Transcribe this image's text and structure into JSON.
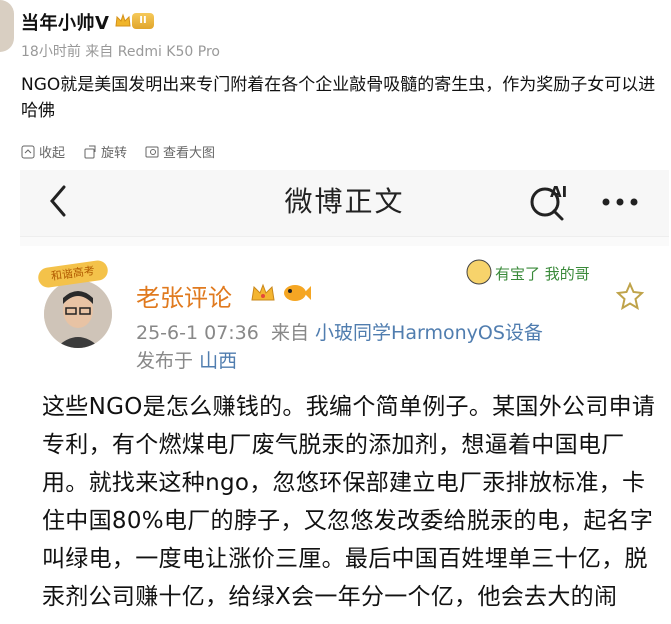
{
  "outer_post": {
    "username": "当年小帅V",
    "badge_level": "II",
    "time": "18小时前",
    "source": "来自 Redmi K50 Pro",
    "text": "NGO就是美国发明出来专门附着在各个企业敲骨吸髓的寄生虫，作为奖励子女可以进哈佛",
    "actions": [
      {
        "label": "收起",
        "icon": "collapse-icon"
      },
      {
        "label": "旋转",
        "icon": "rotate-icon"
      },
      {
        "label": "查看大图",
        "icon": "view-image-icon"
      }
    ]
  },
  "embedded_screenshot": {
    "header_title": "微博正文",
    "ai_label": "AI",
    "post": {
      "avatar_tag": "和谐高考",
      "author": "老张评论",
      "timestamp": "25-6-1 07:36",
      "source_prefix": "来自",
      "source_device": "小玻同学HarmonyOS设备",
      "location_prefix": "发布于",
      "location": "山西",
      "sticker_text": "有宝了 我的哥",
      "body": "这些NGO是怎么赚钱的。我编个简单例子。某国外公司申请专利，有个燃煤电厂废气脱汞的添加剂，想逼着中国电厂用。就找来这种ngo，忽悠环保部建立电厂汞排放标准，卡住中国80%电厂的脖子，又忽悠发改委给脱汞的电，起名字叫绿电，一度电让涨价三厘。最后中国百姓埋单三十亿，脱汞剂公司赚十亿，给绿X会一年分一个亿，他会去大的闹"
    }
  },
  "colors": {
    "author_orange": "#e07a1f",
    "link_blue": "#507daf",
    "meta_gray": "#999999"
  }
}
